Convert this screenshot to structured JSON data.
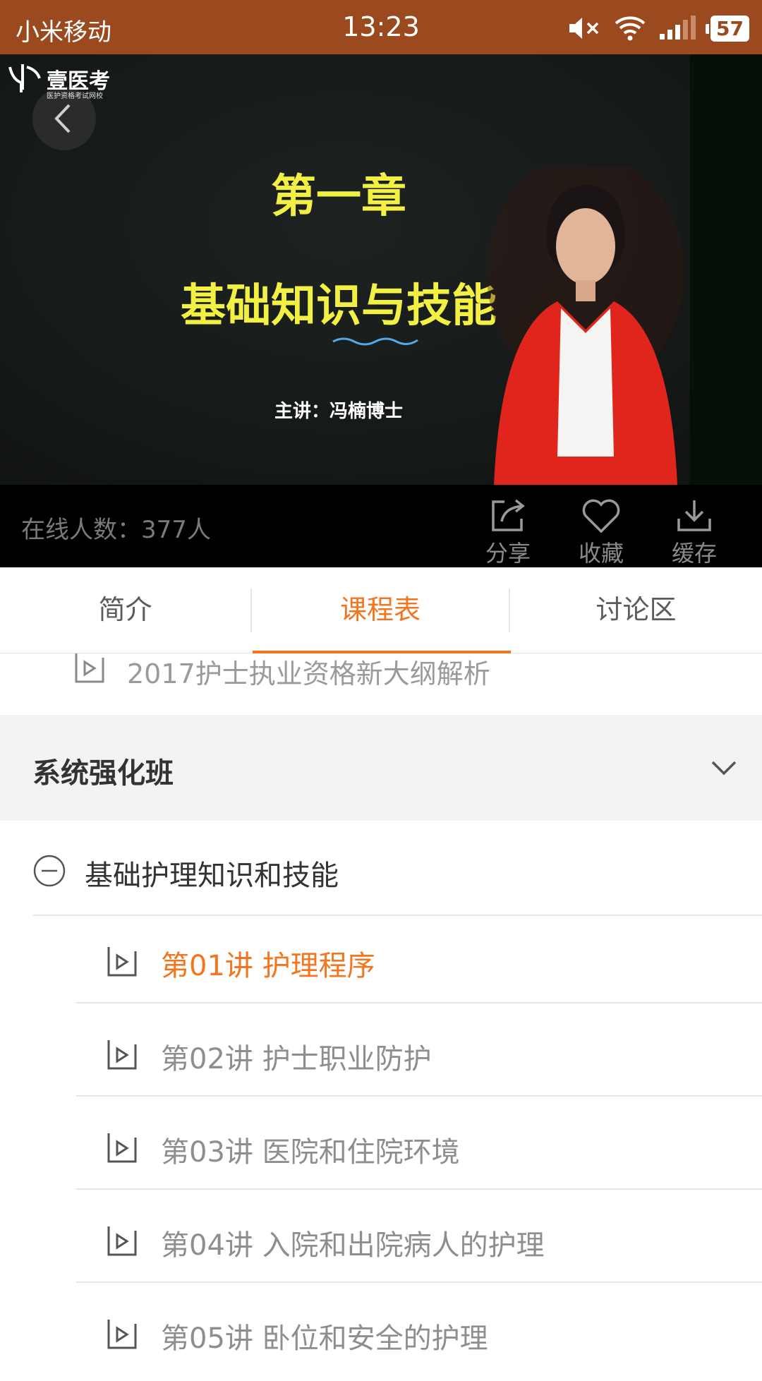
{
  "status_bar": {
    "carrier": "小米移动",
    "time": "13:23",
    "battery": "57"
  },
  "video": {
    "logo_text": "壹医考",
    "logo_subtext": "医护资格考试网校",
    "title_line1": "第一章",
    "title_line2": "基础知识与技能",
    "lecturer": "主讲：冯楠博士"
  },
  "video_bar": {
    "online_count": "在线人数：377人",
    "share_label": "分享",
    "favorite_label": "收藏",
    "cache_label": "缓存"
  },
  "tabs": [
    {
      "label": "简介",
      "active": false
    },
    {
      "label": "课程表",
      "active": true
    },
    {
      "label": "讨论区",
      "active": false
    }
  ],
  "list": {
    "prev_item": "2017护士执业资格新大纲解析",
    "section_title": "系统强化班",
    "group_title": "基础护理知识和技能",
    "lectures": [
      {
        "label": "第01讲 护理程序",
        "active": true
      },
      {
        "label": "第02讲 护士职业防护",
        "active": false
      },
      {
        "label": "第03讲 医院和住院环境",
        "active": false
      },
      {
        "label": "第04讲 入院和出院病人的护理",
        "active": false
      },
      {
        "label": "第05讲 卧位和安全的护理",
        "active": false
      }
    ]
  },
  "colors": {
    "status_bar": "#9a4a1e",
    "accent": "#f5751e",
    "title_yellow": "#f3f044"
  }
}
